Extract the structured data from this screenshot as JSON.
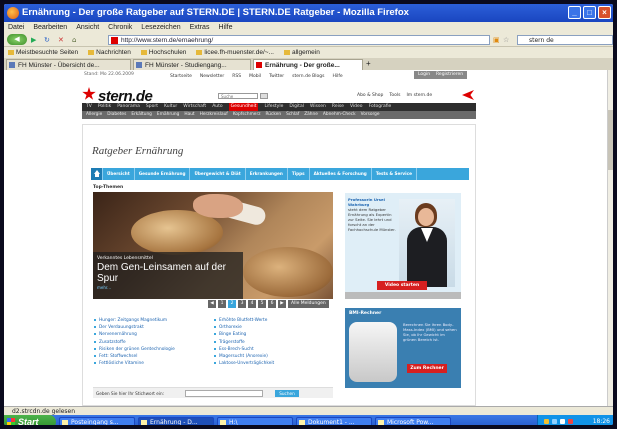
{
  "window": {
    "title": "Ernährung - Der große Ratgeber auf STERN.DE | STERN.DE Ratgeber - Mozilla Firefox"
  },
  "menu": [
    "Datei",
    "Bearbeiten",
    "Ansicht",
    "Chronik",
    "Lesezeichen",
    "Extras",
    "Hilfe"
  ],
  "nav": {
    "url": "http://www.stern.de/ernaehrung/",
    "search_value": "stern de"
  },
  "bookmarks": [
    "Meistbesuchte Seiten",
    "Nachrichten",
    "Hochschulen",
    "licee.fh-muenster.de/~...",
    "allgemein"
  ],
  "tabs": [
    {
      "label": "FH Münster - Übersicht de...",
      "active": false
    },
    {
      "label": "FH Münster - Studiengang...",
      "active": false
    },
    {
      "label": "Ernährung - Der große...",
      "active": true
    }
  ],
  "site": {
    "date": "Stand: Mo 22.06.2009",
    "dashboard": [
      "Startseite",
      "Newsletter",
      "RSS",
      "Mobil",
      "Twitter",
      "stern.de Blogs",
      "Hilfe"
    ],
    "login": "Login",
    "register": "Registrieren",
    "logo": "stern.de",
    "search_placeholder": "Suche",
    "topright": [
      "Abo & Shop",
      "Tools",
      "Im stern.de"
    ],
    "mainnav": [
      "TV",
      "Politik",
      "Panorama",
      "Sport",
      "Kultur",
      "Wirtschaft",
      "Auto",
      "Gesundheit",
      "Lifestyle",
      "Digital",
      "Wissen",
      "Reise",
      "Video",
      "Fotografie"
    ],
    "mainnav_active": "Gesundheit",
    "subnav": [
      "Allergie",
      "Diabetes",
      "Erkältung",
      "Ernährung",
      "Haut",
      "Herzkreislauf",
      "Kopfschmerz",
      "Rücken",
      "Schlaf",
      "Zähne",
      "Abnehm-Check",
      "Vorsorge"
    ]
  },
  "page": {
    "title": "Ratgeber Ernährung",
    "ressorts": [
      "Übersicht",
      "Gesunde Ernährung",
      "Übergewicht & Diät",
      "Erkrankungen",
      "Tipps",
      "Aktuelles & Forschung",
      "Tests & Service"
    ],
    "top_label": "Top-Themen",
    "hero": {
      "kicker": "Verkanntes Lebensmittel",
      "headline": "Dem Gen-Leinsamen auf der Spur",
      "more": "mehr..."
    },
    "pager": [
      "1",
      "2",
      "3",
      "4",
      "5",
      "6"
    ],
    "pager_active": "2",
    "pager_all": "Alle Meldungen",
    "links_left": [
      "Hunger: Zeitgangs Magnetikum",
      "Der Verdauungstrakt",
      "Nervenernährung",
      "Zusatzstoffe",
      "Risiken der grünen Gentechnologie",
      "Fett: Stoffwechsel",
      "Fettlösliche Vitamine"
    ],
    "links_right": [
      "Erhöhte Blutfett-Werte",
      "Orthorexie",
      "Binge Eating",
      "Trägerstoffe",
      "Ess-Brech-Sucht",
      "Magersucht (Anorexie)",
      "Laktose-Unverträglichkeit"
    ],
    "search_label": "Geben Sie hier Ihr Stichwort ein:",
    "search_button": "Suchen"
  },
  "expert": {
    "name": "Professorin Ursel Wahrburg",
    "text": "steht dem Ratgeber Ernährung als Expertin zur Seite. Sie lehrt und forscht an der Fachhochschule Münster.",
    "button": "Video starten"
  },
  "bmi": {
    "title": "BMI-Rechner",
    "text": "Berechnen Sie Ihren Body-Mass-Index (BMI) und sehen Sie, ob Ihr Gewicht im grünen Bereich ist.",
    "button": "Zum Rechner"
  },
  "status": "d2.strcdn.de gelesen",
  "taskbar": {
    "start": "Start",
    "items": [
      "Posteingang s...",
      "Ernährung - D...",
      "H:\\",
      "Dokument1 - ...",
      "Microsoft Pow..."
    ],
    "active_index": 1,
    "clock": "18:26"
  },
  "colors": {
    "xp_blue": "#2457c8",
    "stern_red": "#d00000",
    "ressort_blue": "#3aa6dc"
  }
}
